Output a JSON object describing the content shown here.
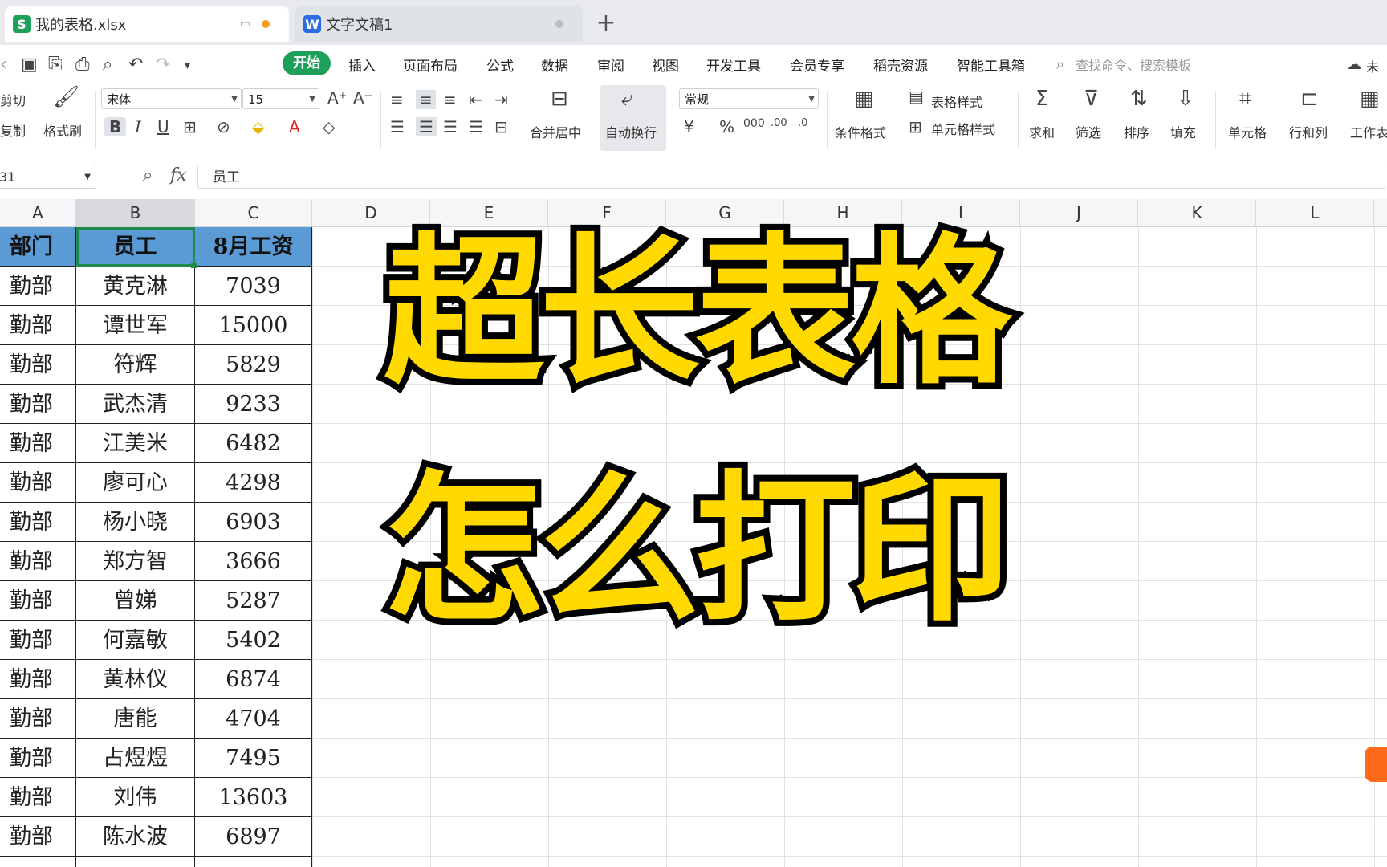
{
  "tabs": [
    {
      "label": "我的表格.xlsx",
      "icon": "S",
      "icon_color": "#1fa05a",
      "active": true
    },
    {
      "label": "文字文稿1",
      "icon": "W",
      "icon_color": "#2b6de0",
      "active": false
    }
  ],
  "menu": {
    "items": [
      "开始",
      "插入",
      "页面布局",
      "公式",
      "数据",
      "审阅",
      "视图",
      "开发工具",
      "会员专享",
      "稻壳资源",
      "智能工具箱"
    ],
    "search_placeholder": "查找命令、搜索模板",
    "cloud_label": "未"
  },
  "ribbon": {
    "cut": "剪切",
    "copy": "复制",
    "format_painter": "格式刷",
    "font_name": "宋体",
    "font_size": "15",
    "merge_center": "合并居中",
    "wrap_text": "自动换行",
    "number_format": "常规",
    "conditional_format": "条件格式",
    "table_style": "表格样式",
    "cell_style": "单元格样式",
    "sum": "求和",
    "filter": "筛选",
    "sort": "排序",
    "fill": "填充",
    "cell": "单元格",
    "row_col": "行和列",
    "worksheet": "工作表"
  },
  "formula_bar": {
    "cell_ref": "31",
    "fx": "fx",
    "value": "员工"
  },
  "columns": [
    "A",
    "B",
    "C",
    "D",
    "E",
    "F",
    "G",
    "H",
    "I",
    "J",
    "K",
    "L"
  ],
  "active_column": "B",
  "table": {
    "headers": [
      "部门",
      "员工",
      "8月工资"
    ],
    "dept_visible": "勤部",
    "rows": [
      {
        "name": "黄克淋",
        "salary": "7039"
      },
      {
        "name": "谭世军",
        "salary": "15000"
      },
      {
        "name": "符辉",
        "salary": "5829"
      },
      {
        "name": "武杰清",
        "salary": "9233"
      },
      {
        "name": "江美米",
        "salary": "6482"
      },
      {
        "name": "廖可心",
        "salary": "4298"
      },
      {
        "name": "杨小晓",
        "salary": "6903"
      },
      {
        "name": "郑方智",
        "salary": "3666"
      },
      {
        "name": "曾娣",
        "salary": "5287"
      },
      {
        "name": "何嘉敏",
        "salary": "5402"
      },
      {
        "name": "黄林仪",
        "salary": "6874"
      },
      {
        "name": "唐能",
        "salary": "4704"
      },
      {
        "name": "占煜煜",
        "salary": "7495"
      },
      {
        "name": "刘伟",
        "salary": "13603"
      },
      {
        "name": "陈水波",
        "salary": "6897"
      }
    ]
  },
  "overlay": {
    "line1": "超长表格",
    "line2": "怎么打印",
    "fill_color": "#ffd900"
  }
}
